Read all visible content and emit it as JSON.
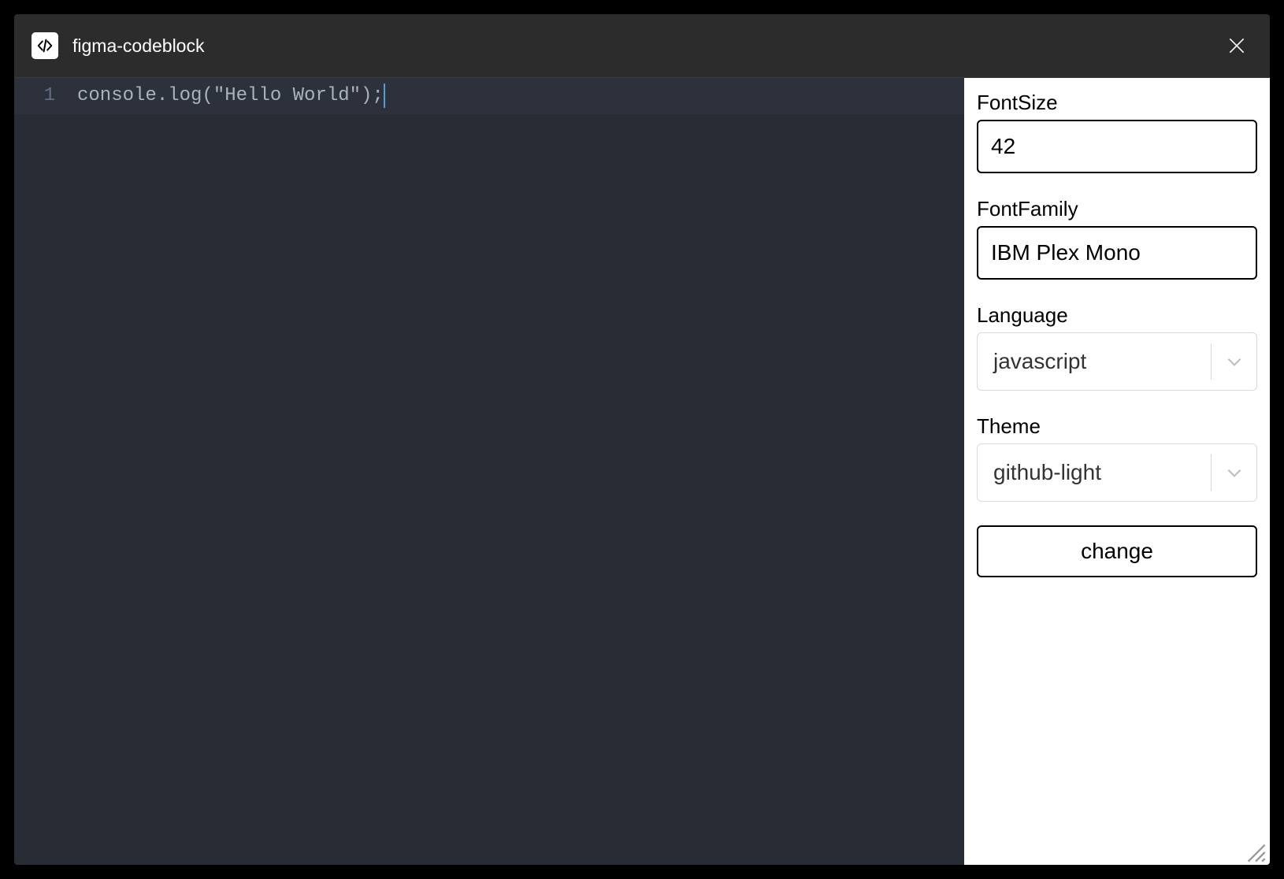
{
  "header": {
    "title": "figma-codeblock"
  },
  "editor": {
    "lineNumber": "1",
    "code": "console.log(\"Hello World\");"
  },
  "sidebar": {
    "fontSize": {
      "label": "FontSize",
      "value": "42"
    },
    "fontFamily": {
      "label": "FontFamily",
      "value": "IBM Plex Mono"
    },
    "language": {
      "label": "Language",
      "value": "javascript"
    },
    "theme": {
      "label": "Theme",
      "value": "github-light"
    },
    "changeButton": "change"
  }
}
